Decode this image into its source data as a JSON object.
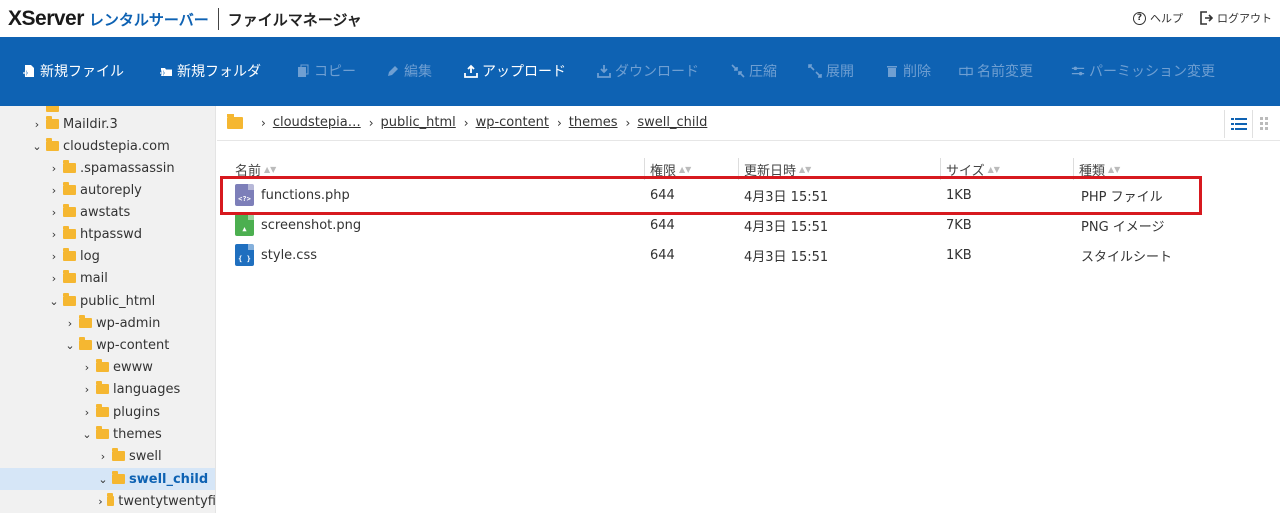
{
  "header": {
    "brand_x": "XServer",
    "brand_rental": "レンタルサーバー",
    "brand_product": "ファイルマネージャ",
    "help_label": "ヘルプ",
    "logout_label": "ログアウト"
  },
  "toolbar": {
    "new_file": "新規ファイル",
    "new_folder": "新規フォルダ",
    "copy": "コピー",
    "edit": "編集",
    "upload": "アップロード",
    "download": "ダウンロード",
    "compress": "圧縮",
    "extract": "展開",
    "delete": "削除",
    "rename": "名前変更",
    "permission": "パーミッション変更"
  },
  "sidebar": {
    "items": [
      {
        "label": "Maildir.3",
        "expanded": false
      },
      {
        "label": "cloudstepia.com",
        "expanded": true
      },
      {
        "label": ".spamassassin",
        "expanded": false
      },
      {
        "label": "autoreply",
        "expanded": false
      },
      {
        "label": "awstats",
        "expanded": false
      },
      {
        "label": "htpasswd",
        "expanded": false
      },
      {
        "label": "log",
        "expanded": false
      },
      {
        "label": "mail",
        "expanded": false
      },
      {
        "label": "public_html",
        "expanded": true
      },
      {
        "label": "wp-admin",
        "expanded": false
      },
      {
        "label": "wp-content",
        "expanded": true
      },
      {
        "label": "ewww",
        "expanded": false
      },
      {
        "label": "languages",
        "expanded": false
      },
      {
        "label": "plugins",
        "expanded": false
      },
      {
        "label": "themes",
        "expanded": true
      },
      {
        "label": "swell",
        "expanded": false
      },
      {
        "label": "swell_child",
        "expanded": true,
        "selected": true
      },
      {
        "label": "twentytwentyfi",
        "expanded": false
      }
    ]
  },
  "breadcrumb": {
    "items": [
      "cloudstepia…",
      "public_html",
      "wp-content",
      "themes",
      "swell_child"
    ]
  },
  "table": {
    "columns": [
      "名前",
      "権限",
      "更新日時",
      "サイズ",
      "種類"
    ],
    "rows": [
      {
        "name": "functions.php",
        "perm": "644",
        "date": "4月3日 15:51",
        "size": "1KB",
        "type": "PHP ファイル",
        "icon": "php-file-icon"
      },
      {
        "name": "screenshot.png",
        "perm": "644",
        "date": "4月3日 15:51",
        "size": "7KB",
        "type": "PNG イメージ",
        "icon": "image-file-icon"
      },
      {
        "name": "style.css",
        "perm": "644",
        "date": "4月3日 15:51",
        "size": "1KB",
        "type": "スタイルシート",
        "icon": "css-file-icon"
      }
    ]
  },
  "colors": {
    "toolbar": "#0e62b3",
    "brand_blue": "#0e62b3",
    "folder": "#f5b731",
    "highlight": "#d7191f",
    "disabled_tool": "#6f9fd2"
  }
}
